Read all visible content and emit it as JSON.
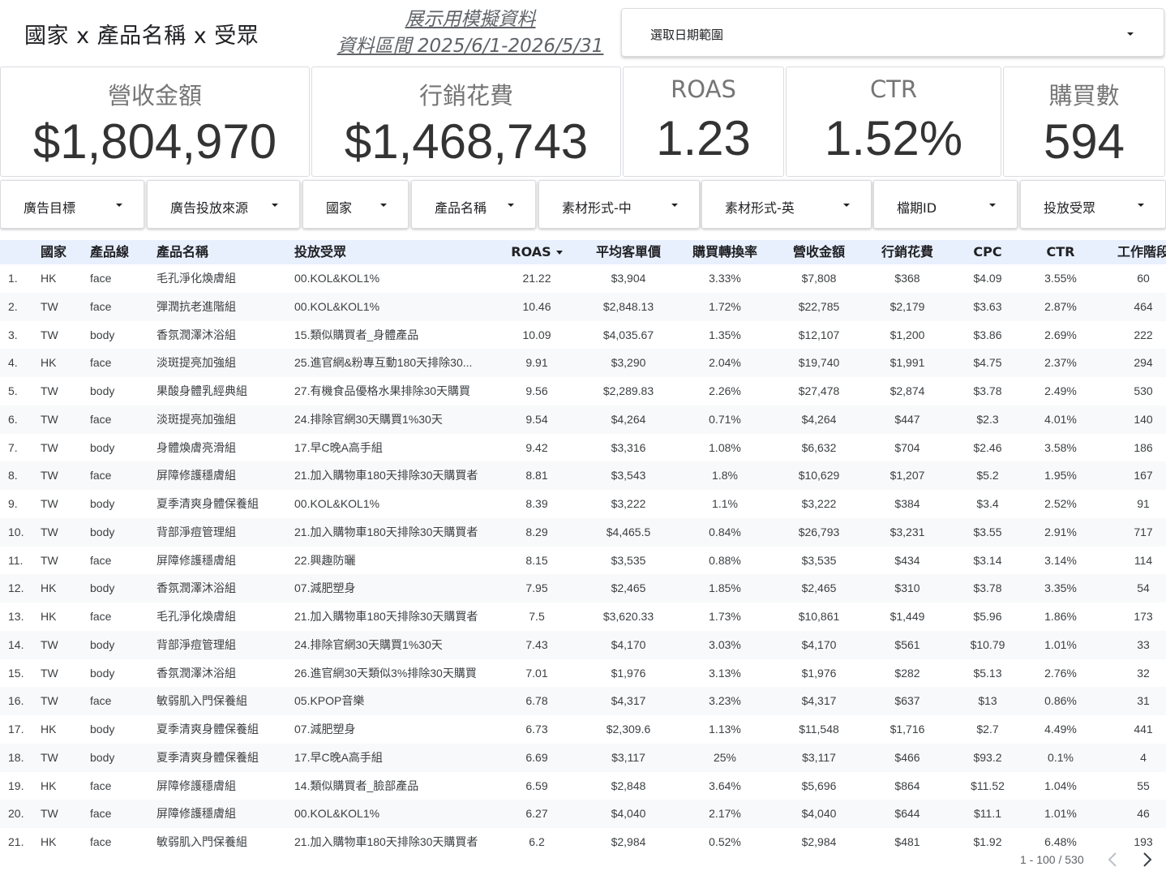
{
  "header": {
    "title": "國家 x 產品名稱 x 受眾",
    "mock_line1": "展示用模擬資料",
    "mock_line2": "資料區間 2025/6/1-2026/5/31",
    "date_picker_label": "選取日期範圍"
  },
  "kpis": [
    {
      "label": "營收金額",
      "value": "$1,804,970"
    },
    {
      "label": "行銷花費",
      "value": "$1,468,743"
    },
    {
      "label": "ROAS",
      "value": "1.23"
    },
    {
      "label": "CTR",
      "value": "1.52%"
    },
    {
      "label": "購買數",
      "value": "594"
    }
  ],
  "filters": [
    "廣告目標",
    "廣告投放來源",
    "國家",
    "產品名稱",
    "素材形式-中",
    "素材形式-英",
    "檔期ID",
    "投放受眾"
  ],
  "table": {
    "columns": [
      "",
      "國家",
      "產品線",
      "產品名稱",
      "投放受眾",
      "ROAS",
      "平均客單價",
      "購買轉換率",
      "營收金額",
      "行銷花費",
      "CPC",
      "CTR",
      "工作階段"
    ],
    "rows": [
      [
        "1.",
        "HK",
        "face",
        "毛孔淨化煥膚組",
        "00.KOL&KOL1%",
        "21.22",
        "$3,904",
        "3.33%",
        "$7,808",
        "$368",
        "$4.09",
        "3.55%",
        "60"
      ],
      [
        "2.",
        "TW",
        "face",
        "彈潤抗老進階組",
        "00.KOL&KOL1%",
        "10.46",
        "$2,848.13",
        "1.72%",
        "$22,785",
        "$2,179",
        "$3.63",
        "2.87%",
        "464"
      ],
      [
        "3.",
        "TW",
        "body",
        "香氛潤澤沐浴組",
        "15.類似購買者_身體產品",
        "10.09",
        "$4,035.67",
        "1.35%",
        "$12,107",
        "$1,200",
        "$3.86",
        "2.69%",
        "222"
      ],
      [
        "4.",
        "HK",
        "face",
        "淡斑提亮加強組",
        "25.進官網&粉專互動180天排除30...",
        "9.91",
        "$3,290",
        "2.04%",
        "$19,740",
        "$1,991",
        "$4.75",
        "2.37%",
        "294"
      ],
      [
        "5.",
        "TW",
        "body",
        "果酸身體乳經典組",
        "27.有機食品優格水果排除30天購買",
        "9.56",
        "$2,289.83",
        "2.26%",
        "$27,478",
        "$2,874",
        "$3.78",
        "2.49%",
        "530"
      ],
      [
        "6.",
        "TW",
        "face",
        "淡斑提亮加強組",
        "24.排除官網30天購買1%30天",
        "9.54",
        "$4,264",
        "0.71%",
        "$4,264",
        "$447",
        "$2.3",
        "4.01%",
        "140"
      ],
      [
        "7.",
        "TW",
        "body",
        "身體煥膚亮滑組",
        "17.早C晚A高手組",
        "9.42",
        "$3,316",
        "1.08%",
        "$6,632",
        "$704",
        "$2.46",
        "3.58%",
        "186"
      ],
      [
        "8.",
        "TW",
        "face",
        "屏障修護穩膚組",
        "21.加入購物車180天排除30天購買者",
        "8.81",
        "$3,543",
        "1.8%",
        "$10,629",
        "$1,207",
        "$5.2",
        "1.95%",
        "167"
      ],
      [
        "9.",
        "TW",
        "body",
        "夏季清爽身體保養組",
        "00.KOL&KOL1%",
        "8.39",
        "$3,222",
        "1.1%",
        "$3,222",
        "$384",
        "$3.4",
        "2.52%",
        "91"
      ],
      [
        "10.",
        "TW",
        "body",
        "背部淨痘管理組",
        "21.加入購物車180天排除30天購買者",
        "8.29",
        "$4,465.5",
        "0.84%",
        "$26,793",
        "$3,231",
        "$3.55",
        "2.91%",
        "717"
      ],
      [
        "11.",
        "TW",
        "face",
        "屏障修護穩膚組",
        "22.興趣防曬",
        "8.15",
        "$3,535",
        "0.88%",
        "$3,535",
        "$434",
        "$3.14",
        "3.14%",
        "114"
      ],
      [
        "12.",
        "HK",
        "body",
        "香氛潤澤沐浴組",
        "07.減肥塑身",
        "7.95",
        "$2,465",
        "1.85%",
        "$2,465",
        "$310",
        "$3.78",
        "3.35%",
        "54"
      ],
      [
        "13.",
        "HK",
        "face",
        "毛孔淨化煥膚組",
        "21.加入購物車180天排除30天購買者",
        "7.5",
        "$3,620.33",
        "1.73%",
        "$10,861",
        "$1,449",
        "$5.96",
        "1.86%",
        "173"
      ],
      [
        "14.",
        "TW",
        "body",
        "背部淨痘管理組",
        "24.排除官網30天購買1%30天",
        "7.43",
        "$4,170",
        "3.03%",
        "$4,170",
        "$561",
        "$10.79",
        "1.01%",
        "33"
      ],
      [
        "15.",
        "TW",
        "body",
        "香氛潤澤沐浴組",
        "26.進官網30天類似3%排除30天購買",
        "7.01",
        "$1,976",
        "3.13%",
        "$1,976",
        "$282",
        "$5.13",
        "2.76%",
        "32"
      ],
      [
        "16.",
        "TW",
        "face",
        "敏弱肌入門保養組",
        "05.KPOP音樂",
        "6.78",
        "$4,317",
        "3.23%",
        "$4,317",
        "$637",
        "$13",
        "0.86%",
        "31"
      ],
      [
        "17.",
        "HK",
        "body",
        "夏季清爽身體保養組",
        "07.減肥塑身",
        "6.73",
        "$2,309.6",
        "1.13%",
        "$11,548",
        "$1,716",
        "$2.7",
        "4.49%",
        "441"
      ],
      [
        "18.",
        "TW",
        "body",
        "夏季清爽身體保養組",
        "17.早C晚A高手組",
        "6.69",
        "$3,117",
        "25%",
        "$3,117",
        "$466",
        "$93.2",
        "0.1%",
        "4"
      ],
      [
        "19.",
        "HK",
        "face",
        "屏障修護穩膚組",
        "14.類似購買者_臉部產品",
        "6.59",
        "$2,848",
        "3.64%",
        "$5,696",
        "$864",
        "$11.52",
        "1.04%",
        "55"
      ],
      [
        "20.",
        "TW",
        "face",
        "屏障修護穩膚組",
        "00.KOL&KOL1%",
        "6.27",
        "$4,040",
        "2.17%",
        "$4,040",
        "$644",
        "$11.1",
        "1.01%",
        "46"
      ],
      [
        "21.",
        "HK",
        "face",
        "敏弱肌入門保養組",
        "21.加入購物車180天排除30天購買者",
        "6.2",
        "$2,984",
        "0.52%",
        "$2,984",
        "$481",
        "$1.92",
        "6.48%",
        "193"
      ]
    ]
  },
  "pagination": {
    "label": "1 - 100 / 530",
    "prev_icon": "chevron-left-icon",
    "next_icon": "chevron-right-icon"
  },
  "colors": {
    "header_bg": "#e8f0fe",
    "alt_row_bg": "#f8f9fa",
    "border": "#dadce0"
  }
}
